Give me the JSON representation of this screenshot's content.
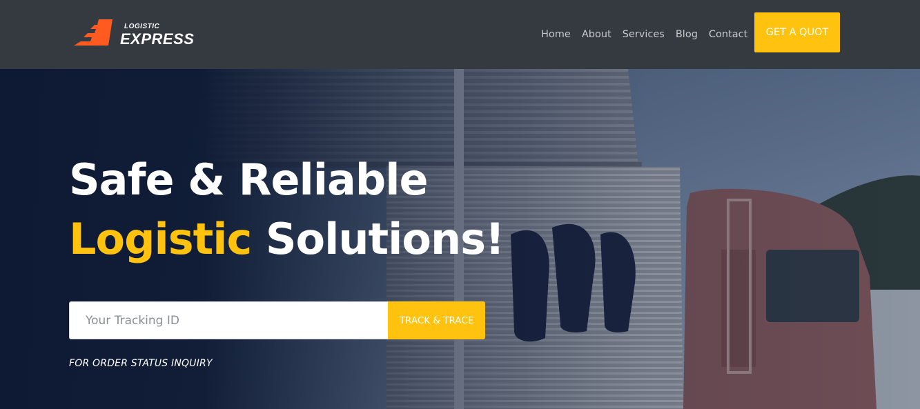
{
  "brand": {
    "small": "LOGISTIC",
    "big": "EXPRESS",
    "logo_icon": "speed-arrow-icon",
    "logo_color": "#ff5a1f"
  },
  "nav": {
    "items": [
      "Home",
      "About",
      "Services",
      "Blog",
      "Contact"
    ],
    "cta_label": "GET A QUOT"
  },
  "hero": {
    "title_line1": "Safe & Reliable",
    "title_accent": "Logistic",
    "title_rest": " Solutions!",
    "tracking_placeholder": "Your Tracking ID",
    "track_button": "TRACK & TRACE",
    "hint": "FOR ORDER STATUS INQUIRY",
    "background_image": "truck-photo"
  },
  "colors": {
    "navbar": "#343a40",
    "accent": "#ffc20e",
    "hero_overlay": "#0e1a34"
  }
}
